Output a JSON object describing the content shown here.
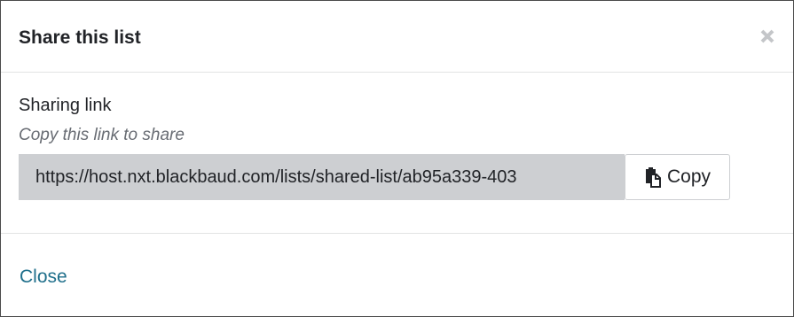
{
  "dialog": {
    "title": "Share this list",
    "close_icon": "close-icon"
  },
  "body": {
    "label": "Sharing link",
    "hint": "Copy this link to share",
    "link_value": "https://host.nxt.blackbaud.com/lists/shared-list/ab95a339-403",
    "copy_label": "Copy",
    "copy_icon": "clipboard-icon"
  },
  "footer": {
    "close_label": "Close"
  },
  "colors": {
    "link_field_bg": "#cdcfd2",
    "close_link": "#1f6f8b",
    "hint_text": "#686c73"
  }
}
